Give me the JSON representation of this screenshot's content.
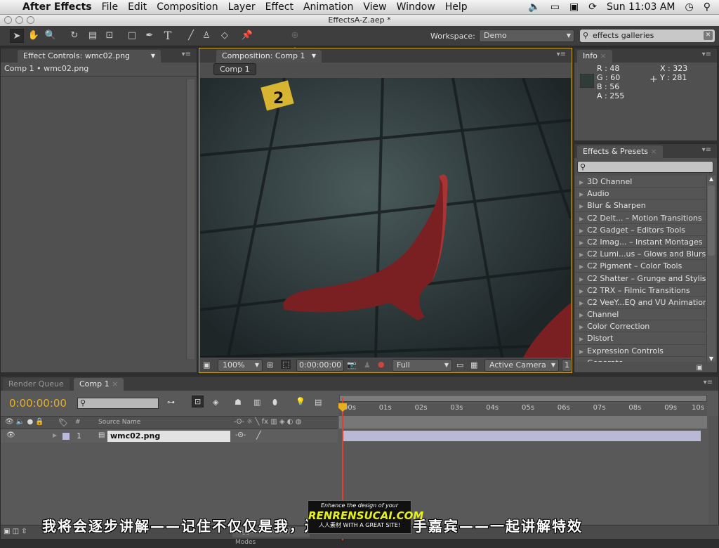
{
  "menubar": {
    "app": "After Effects",
    "items": [
      "File",
      "Edit",
      "Composition",
      "Layer",
      "Effect",
      "Animation",
      "View",
      "Window",
      "Help"
    ],
    "clock": "Sun 11:03 AM"
  },
  "window": {
    "title": "EffectsA-Z.aep *"
  },
  "toolbar": {
    "workspace_label": "Workspace:",
    "workspace_value": "Demo",
    "search_value": "effects galleries"
  },
  "effect_controls": {
    "tab": "Effect Controls: wmc02.png",
    "breadcrumb": "Comp 1 • wmc02.png"
  },
  "composition": {
    "tab": "Composition: Comp 1",
    "comp_button": "Comp 1",
    "zoom": "100%",
    "timecode": "0:00:00:00",
    "resolution": "Full",
    "camera": "Active Camera",
    "view_count": "1",
    "marker_label": "2"
  },
  "info": {
    "tab": "Info",
    "r": "R : 48",
    "g": "G : 60",
    "b": "B : 56",
    "a": "A : 255",
    "x": "X : 323",
    "y": "Y : 281",
    "swatch_color": "#303c38"
  },
  "effects_presets": {
    "tab": "Effects & Presets",
    "search_value": "",
    "items": [
      "3D Channel",
      "Audio",
      "Blur & Sharpen",
      "C2 Delt... – Motion Transitions",
      "C2 Gadget – Editors Tools",
      "C2 Imag... – Instant Montages",
      "C2 Lumi...us – Glows and Blurs",
      "C2 Pigment – Color Tools",
      "C2 Shatter – Grunge and Stylise",
      "C2 TRX – Filmic Transitions",
      "C2 VeeY...EQ and VU Animation",
      "Channel",
      "Color Correction",
      "Distort",
      "Expression Controls",
      "Generate"
    ]
  },
  "timeline": {
    "tabs": [
      "Render Queue",
      "Comp 1"
    ],
    "timecode": "0:00:00:00",
    "search_value": "",
    "source_name_header": "Source Name",
    "number_header": "#",
    "ruler": [
      "00s",
      "01s",
      "02s",
      "03s",
      "04s",
      "05s",
      "06s",
      "07s",
      "08s",
      "09s",
      "10s"
    ],
    "layers": [
      {
        "index": "1",
        "name": "wmc02.png",
        "label_color": "#b8b8e0"
      }
    ],
    "toggle_label": "Toggle Switches / Modes"
  },
  "subtitle": "我将会逐步讲解——记住不仅仅是我，还有我请来的高手嘉宾——一起讲解特效",
  "watermark": {
    "line1": "Enhance the design of your",
    "brand": "RENRENSUCAI.COM",
    "line3": "人人素材 WITH A GREAT SITE!"
  },
  "colors": {
    "accent": "#e8b020",
    "playhead": "#e04030"
  }
}
